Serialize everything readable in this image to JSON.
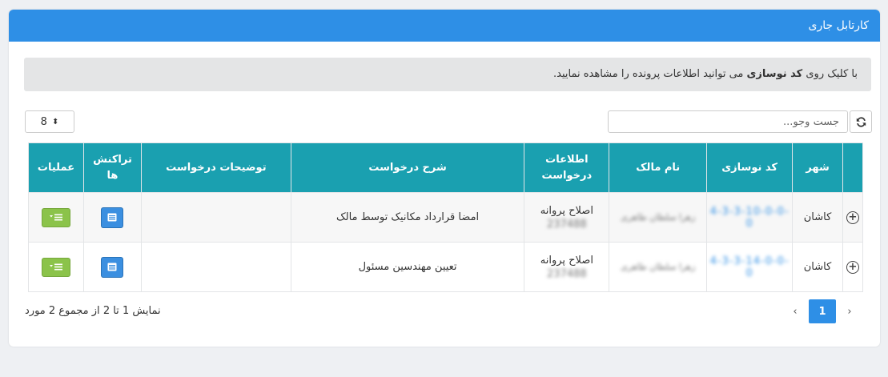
{
  "header": {
    "title": "کارتابل جاری"
  },
  "alert": {
    "prefix": "با کلیک روی",
    "bold": "کد نوسازی",
    "suffix": "می توانید اطلاعات پرونده را مشاهده نمایید."
  },
  "search": {
    "placeholder": "جست وجو..."
  },
  "page_size": {
    "value": "8"
  },
  "table": {
    "headers": {
      "city": "شهر",
      "code": "کد نوسازی",
      "owner": "نام مالک",
      "info_line1": "اطلاعات",
      "info_line2": "درخواست",
      "description": "شرح درخواست",
      "notes": "توضیحات درخواست",
      "tx_line1": "تراکنش",
      "tx_line2": "ها",
      "ops": "عملیات"
    },
    "rows": [
      {
        "city": "کاشان",
        "code": "4-3-3-10-0-0-0",
        "owner": "زهرا سلطان طاهری",
        "info_title": "اصلاح پروانه",
        "info_number": "237488",
        "description": "امضا قرارداد مکانیک توسط مالک",
        "notes": ""
      },
      {
        "city": "کاشان",
        "code": "4-3-3-14-0-0-0",
        "owner": "زهرا سلطان طاهری",
        "info_title": "اصلاح پروانه",
        "info_number": "237488",
        "description": "تعیین مهندسین مسئول",
        "notes": ""
      }
    ]
  },
  "pagination": {
    "current": "1",
    "prev": "‹",
    "next": "›"
  },
  "summary": {
    "text": "نمایش 1 تا 2 از مجموع 2 مورد"
  },
  "icons": {
    "refresh": "refresh-icon",
    "expand": "plus-circle-icon",
    "transactions": "card-list-icon",
    "operations": "menu-dropdown-icon"
  },
  "colors": {
    "header_bg": "#2e8fe6",
    "table_header_bg": "#1aa0b0",
    "transactions_btn": "#3b8fe0",
    "operations_btn": "#8bc34a"
  }
}
